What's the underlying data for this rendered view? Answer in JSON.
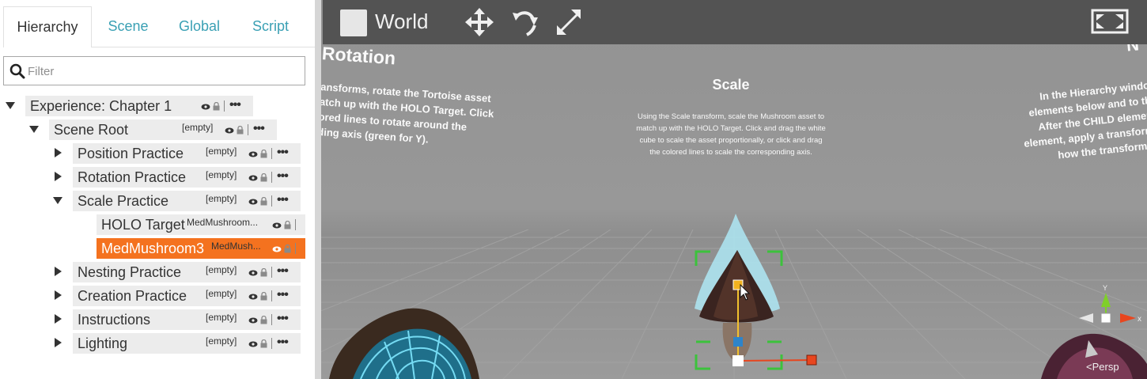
{
  "tabs": [
    {
      "label": "Hierarchy"
    },
    {
      "label": "Scene"
    },
    {
      "label": "Global"
    },
    {
      "label": "Script"
    }
  ],
  "filter": {
    "placeholder": "Filter",
    "icon": "search-icon"
  },
  "tree": [
    {
      "label": "Experience: Chapter 1",
      "tag": "",
      "expanded": true
    },
    {
      "label": "Scene Root",
      "tag": "[empty]",
      "expanded": true
    },
    {
      "label": "Position Practice",
      "tag": "[empty]",
      "expanded": false
    },
    {
      "label": "Rotation Practice",
      "tag": "[empty]",
      "expanded": false
    },
    {
      "label": "Scale Practice",
      "tag": "[empty]",
      "expanded": true
    },
    {
      "label": "HOLO Target",
      "tag": "MedMushroom..."
    },
    {
      "label": "MedMushroom3",
      "tag": "MedMush...",
      "selected": true
    },
    {
      "label": "Nesting Practice",
      "tag": "[empty]",
      "expanded": false
    },
    {
      "label": "Creation Practice",
      "tag": "[empty]",
      "expanded": false
    },
    {
      "label": "Instructions",
      "tag": "[empty]",
      "expanded": false
    },
    {
      "label": "Lighting",
      "tag": "[empty]",
      "expanded": false
    }
  ],
  "more_glyph": "•••",
  "viewport": {
    "space_label": "World",
    "rotation_title": "Rotation",
    "rotation_text": "ansforms, rotate the Tortoise asset\natch up with the HOLO Target. Click\nored lines to rotate around the\nding axis (green for Y).",
    "scale_title": "Scale",
    "scale_text": "Using the Scale transform, scale the Mushroom asset to\nmatch up with the HOLO Target. Click and drag the white\ncube to scale the asset proportionally, or click and drag\nthe colored lines to scale the corresponding axis.",
    "right_title": "N",
    "right_text": "In the Hierarchy windo\nelements below and to th\nAfter the CHILD elemen\nelement, apply a transform\nhow the transform a",
    "gizmo_y": "Y",
    "gizmo_x": "x",
    "persp_label": "<Persp"
  },
  "colors": {
    "selected": "#f4721f",
    "tab_link": "#3aa0b4",
    "toolbar": "#535353",
    "axis_x": "#e8461f",
    "axis_y": "#7fcf2a",
    "selection_box": "#3cc23c"
  }
}
